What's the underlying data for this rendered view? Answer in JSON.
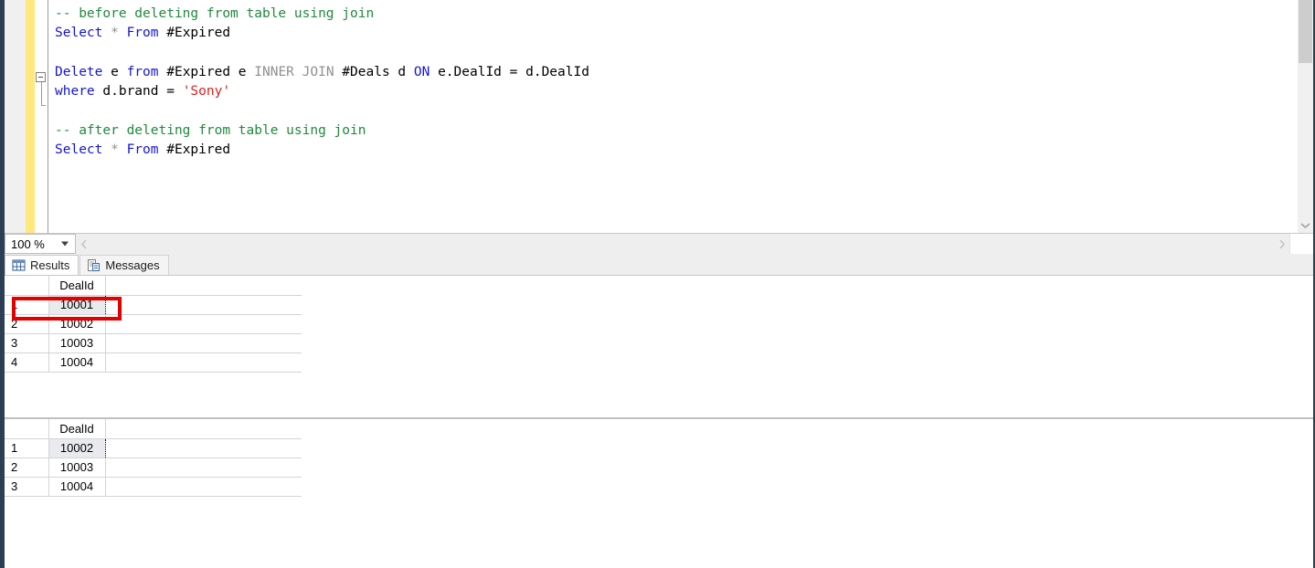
{
  "window": {
    "accent_border_color": "#2c3e56",
    "background": "#ffffff"
  },
  "editor": {
    "change_strip_color": "#ffe97f",
    "fold_marker": "minus",
    "zoom_level": "100 %",
    "scroll": {
      "vertical_down_icon": "chevron-down-icon",
      "horizontal_left_icon": "chevron-left-icon",
      "horizontal_right_icon": "chevron-right-icon"
    },
    "syntax_colors": {
      "comment": "#1f8a3b",
      "keyword": "#1515d6",
      "operator_gray": "#909090",
      "string": "#e02020",
      "identifier": "#000000"
    },
    "lines": [
      {
        "tokens": [
          {
            "t": "-- before deleting from table using join",
            "c": "comment"
          }
        ]
      },
      {
        "tokens": [
          {
            "t": "Select ",
            "c": "kw"
          },
          {
            "t": "* ",
            "c": "gray"
          },
          {
            "t": "From ",
            "c": "kw"
          },
          {
            "t": "#Expired",
            "c": "plain"
          }
        ]
      },
      {
        "tokens": [
          {
            "t": "",
            "c": "plain"
          }
        ]
      },
      {
        "tokens": [
          {
            "t": "Delete ",
            "c": "kw"
          },
          {
            "t": "e ",
            "c": "plain"
          },
          {
            "t": "from ",
            "c": "kw"
          },
          {
            "t": "#Expired e ",
            "c": "plain"
          },
          {
            "t": "INNER JOIN ",
            "c": "gray"
          },
          {
            "t": "#Deals d ",
            "c": "plain"
          },
          {
            "t": "ON ",
            "c": "kw"
          },
          {
            "t": "e.DealId = d.DealId",
            "c": "plain"
          }
        ]
      },
      {
        "tokens": [
          {
            "t": "where ",
            "c": "kw"
          },
          {
            "t": "d.brand = ",
            "c": "plain"
          },
          {
            "t": "'Sony'",
            "c": "str"
          }
        ]
      },
      {
        "tokens": [
          {
            "t": "",
            "c": "plain"
          }
        ]
      },
      {
        "tokens": [
          {
            "t": "-- after deleting from table using join",
            "c": "comment"
          }
        ]
      },
      {
        "tokens": [
          {
            "t": "Select ",
            "c": "kw"
          },
          {
            "t": "* ",
            "c": "gray"
          },
          {
            "t": "From ",
            "c": "kw"
          },
          {
            "t": "#Expired",
            "c": "plain"
          }
        ]
      }
    ]
  },
  "results": {
    "tabs": [
      {
        "label": "Results",
        "icon": "grid-icon",
        "active": true
      },
      {
        "label": "Messages",
        "icon": "message-document-icon",
        "active": false
      }
    ],
    "grids": [
      {
        "name": "before-delete-grid",
        "columns": [
          "DealId"
        ],
        "rows": [
          {
            "num": "1",
            "values": [
              "10001"
            ],
            "selected": true
          },
          {
            "num": "2",
            "values": [
              "10002"
            ],
            "selected": false
          },
          {
            "num": "3",
            "values": [
              "10003"
            ],
            "selected": false
          },
          {
            "num": "4",
            "values": [
              "10004"
            ],
            "selected": false
          }
        ],
        "annotation": {
          "type": "red-rectangle",
          "color": "#e20000",
          "target_row": "1"
        }
      },
      {
        "name": "after-delete-grid",
        "columns": [
          "DealId"
        ],
        "rows": [
          {
            "num": "1",
            "values": [
              "10002"
            ],
            "selected": true
          },
          {
            "num": "2",
            "values": [
              "10003"
            ],
            "selected": false
          },
          {
            "num": "3",
            "values": [
              "10004"
            ],
            "selected": false
          }
        ],
        "annotation": null
      }
    ]
  }
}
